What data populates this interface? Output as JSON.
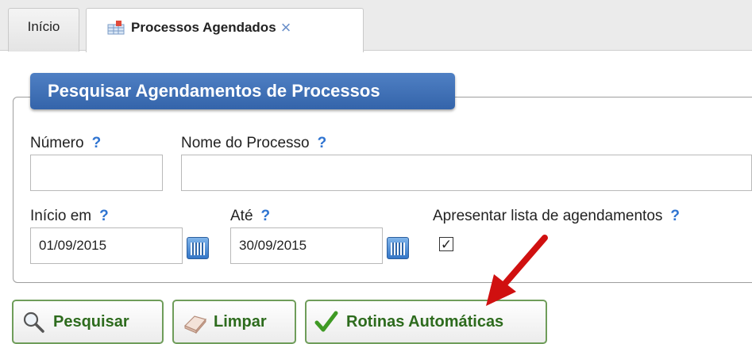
{
  "tabs": {
    "home_label": "Início",
    "active_label": "Processos Agendados",
    "close_symbol": "×",
    "active_icon": "table-calendar-icon"
  },
  "panel": {
    "title": "Pesquisar Agendamentos de Processos"
  },
  "fields": {
    "numero": {
      "label": "Número",
      "value": ""
    },
    "nome_processo": {
      "label": "Nome do Processo",
      "value": ""
    },
    "inicio_em": {
      "label": "Início em",
      "value": "01/09/2015"
    },
    "ate": {
      "label": "Até",
      "value": "30/09/2015"
    },
    "apresentar_lista": {
      "label": "Apresentar lista de agendamentos",
      "checked": true,
      "check_symbol": "✓"
    }
  },
  "help_symbol": "?",
  "buttons": {
    "search": "Pesquisar",
    "clear": "Limpar",
    "auto": "Rotinas Automáticas"
  },
  "colors": {
    "legend_bg": "#3c6db4",
    "help": "#2f74d1",
    "button_text": "#2d6b1d",
    "arrow": "#d01010"
  }
}
